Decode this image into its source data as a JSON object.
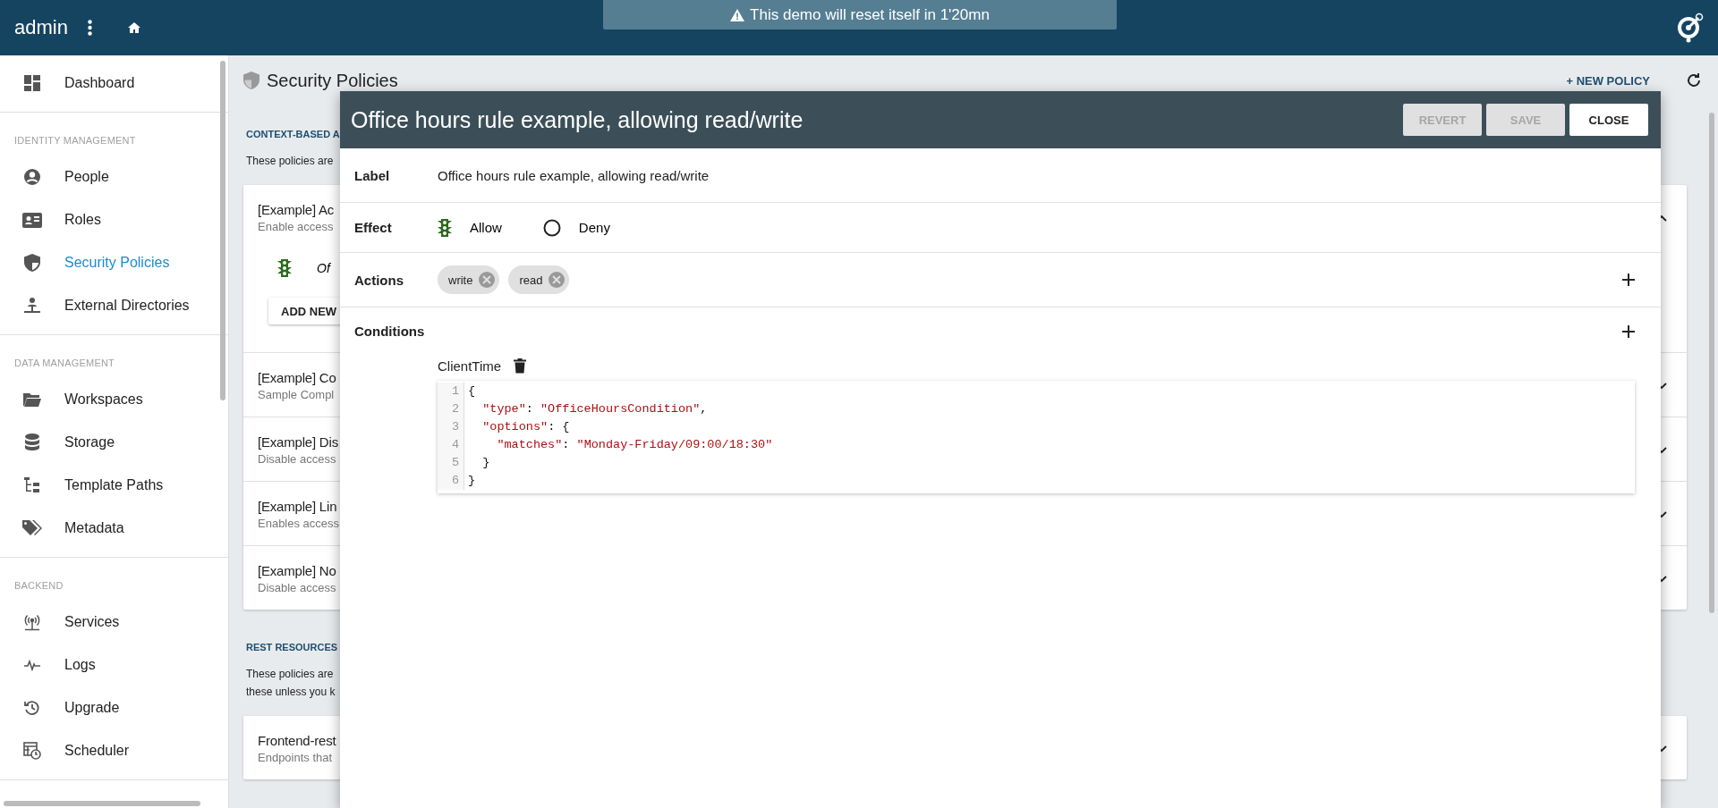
{
  "topbar": {
    "user": "admin",
    "banner": "This demo will reset itself in 1'20mn"
  },
  "sidebar": {
    "sections": [
      {
        "items": [
          {
            "label": "Dashboard",
            "selected": false
          }
        ]
      },
      {
        "title": "IDENTITY MANAGEMENT",
        "items": [
          {
            "label": "People",
            "selected": false
          },
          {
            "label": "Roles",
            "selected": false
          },
          {
            "label": "Security Policies",
            "selected": true
          },
          {
            "label": "External Directories",
            "selected": false
          }
        ]
      },
      {
        "title": "DATA MANAGEMENT",
        "items": [
          {
            "label": "Workspaces",
            "selected": false
          },
          {
            "label": "Storage",
            "selected": false
          },
          {
            "label": "Template Paths",
            "selected": false
          },
          {
            "label": "Metadata",
            "selected": false
          }
        ]
      },
      {
        "title": "BACKEND",
        "items": [
          {
            "label": "Services",
            "selected": false
          },
          {
            "label": "Logs",
            "selected": false
          },
          {
            "label": "Upgrade",
            "selected": false
          },
          {
            "label": "Scheduler",
            "selected": false
          }
        ]
      }
    ]
  },
  "page": {
    "title": "Security Policies",
    "new_button": "+ NEW POLICY",
    "groups": [
      {
        "heading": "CONTEXT-BASED A",
        "description": [
          "These policies are"
        ],
        "cards": [
          {
            "title": "[Example] Ac",
            "subtitle": "Enable access",
            "expanded": true,
            "rules": [
              {
                "label": "Of"
              }
            ],
            "add_button": "ADD NEW"
          },
          {
            "title": "[Example] Co",
            "subtitle": "Sample Compl",
            "expanded": false
          },
          {
            "title": "[Example] Dis",
            "subtitle": "Disable access",
            "expanded": false
          },
          {
            "title": "[Example] Lin",
            "subtitle": "Enables access",
            "expanded": false
          },
          {
            "title": "[Example] No",
            "subtitle": "Disable access",
            "expanded": false
          }
        ]
      },
      {
        "heading": "REST RESOURCES",
        "description": [
          "These policies are",
          "these unless you k"
        ],
        "cards": [
          {
            "title": "Frontend-rest",
            "subtitle": "Endpoints that",
            "expanded": false
          }
        ]
      }
    ]
  },
  "modal": {
    "title": "Office hours rule example, allowing read/write",
    "buttons": [
      {
        "label": "REVERT",
        "disabled": true
      },
      {
        "label": "SAVE",
        "disabled": true
      },
      {
        "label": "CLOSE",
        "disabled": false
      }
    ],
    "label_field": {
      "label": "Label",
      "value": "Office hours rule example, allowing read/write"
    },
    "effect": {
      "label": "Effect",
      "options": [
        {
          "label": "Allow",
          "selected": true
        },
        {
          "label": "Deny",
          "selected": false
        }
      ]
    },
    "actions": {
      "label": "Actions",
      "chips": [
        "write",
        "read"
      ]
    },
    "conditions": {
      "label": "Conditions",
      "items": [
        {
          "name": "ClientTime",
          "code": [
            {
              "n": "1",
              "text": "{"
            },
            {
              "n": "2",
              "text": "  \"type\": \"OfficeHoursCondition\","
            },
            {
              "n": "3",
              "text": "  \"options\": {"
            },
            {
              "n": "4",
              "text": "    \"matches\": \"Monday-Friday/09:00/18:30\""
            },
            {
              "n": "5",
              "text": "  }"
            },
            {
              "n": "6",
              "text": "}"
            }
          ]
        }
      ]
    }
  }
}
